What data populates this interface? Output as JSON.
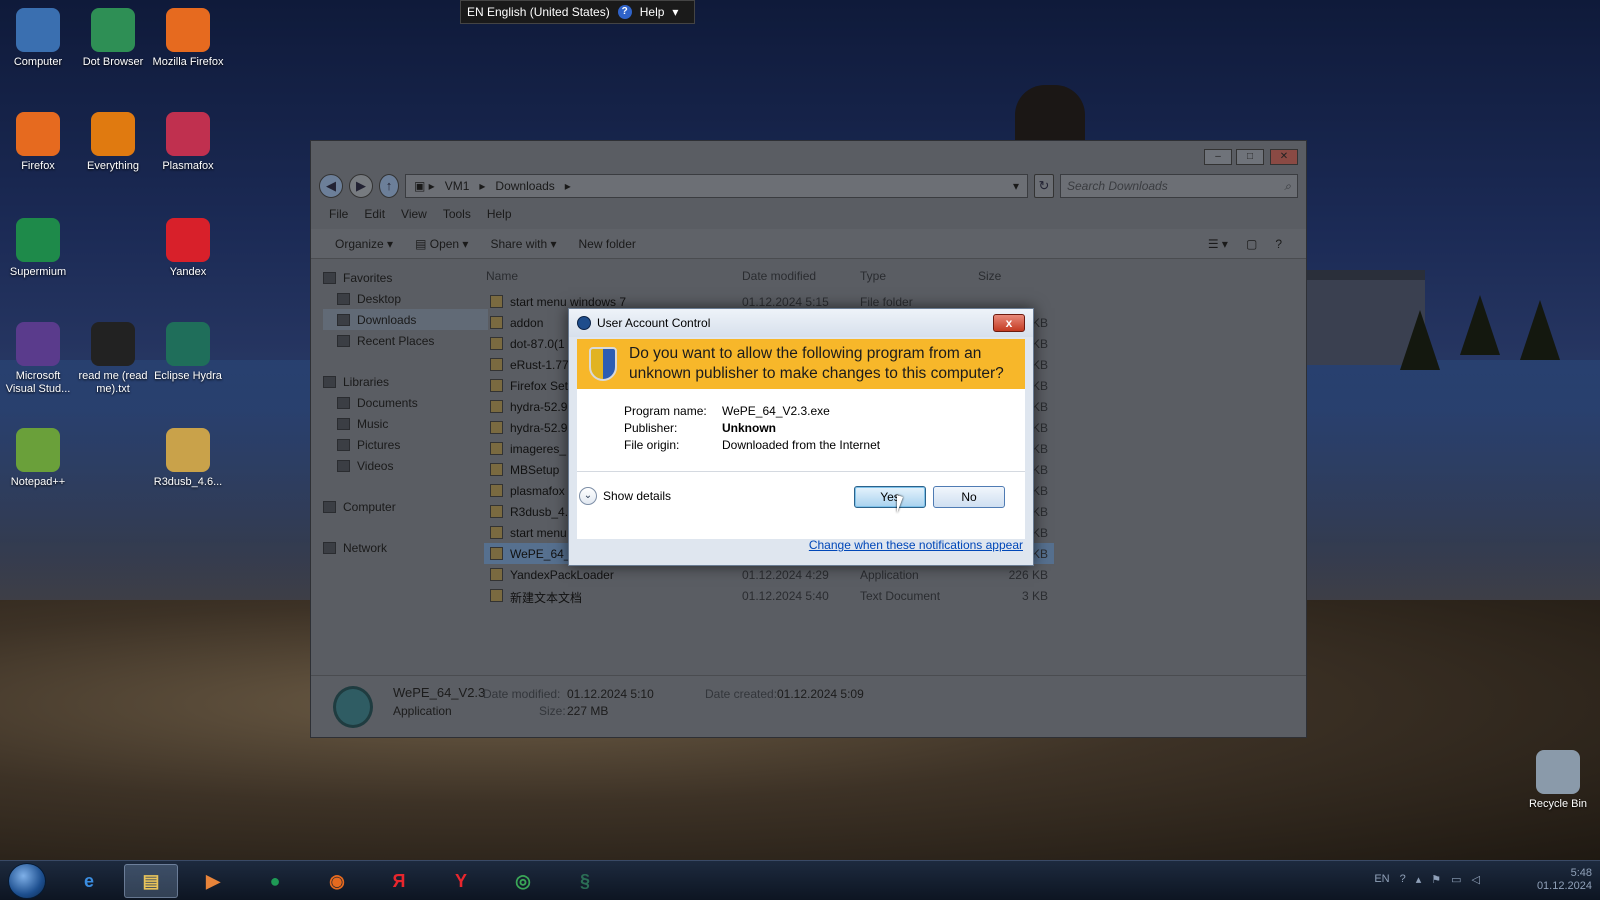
{
  "language_bar": {
    "language": "EN English (United States)",
    "help": "Help"
  },
  "desktop_icons": [
    {
      "label": "Computer",
      "icon": "computer-icon",
      "color": "#3a6fb0"
    },
    {
      "label": "Dot Browser",
      "icon": "dot-browser-icon",
      "color": "#2e8f55"
    },
    {
      "label": "Mozilla Firefox",
      "icon": "firefox-icon",
      "color": "#e66a1f"
    },
    {
      "label": "Firefox",
      "icon": "firefox-icon",
      "color": "#e66a1f"
    },
    {
      "label": "Everything",
      "icon": "everything-icon",
      "color": "#e07a10"
    },
    {
      "label": "Plasmafox",
      "icon": "plasmafox-icon",
      "color": "#c0304f"
    },
    {
      "label": "Supermium",
      "icon": "supermium-icon",
      "color": "#1e8a4a"
    },
    {
      "label": "Yandex",
      "icon": "yandex-icon",
      "color": "#d8202a"
    },
    {
      "label": "Microsoft Visual Stud...",
      "icon": "visual-studio-icon",
      "color": "#5a3b8c"
    },
    {
      "label": "read me (read me).txt",
      "icon": "text-file-icon",
      "color": "#222222"
    },
    {
      "label": "Eclipse Hydra",
      "icon": "eclipse-hydra-icon",
      "color": "#1f6e5a"
    },
    {
      "label": "Notepad++",
      "icon": "notepad-plus-plus-icon",
      "color": "#6aa03a"
    },
    {
      "label": "R3dusb_4.6...",
      "icon": "folder-icon",
      "color": "#c9a24a"
    },
    {
      "label": "Recycle Bin",
      "icon": "recycle-bin-icon",
      "color": "#8a9aaa"
    }
  ],
  "explorer": {
    "breadcrumb": [
      "VM1",
      "Downloads"
    ],
    "search_placeholder": "Search Downloads",
    "menu": [
      "File",
      "Edit",
      "View",
      "Tools",
      "Help"
    ],
    "commands": {
      "organize": "Organize",
      "open": "Open",
      "share": "Share with",
      "new_folder": "New folder"
    },
    "nav": {
      "favorites": "Favorites",
      "fav_items": [
        "Desktop",
        "Downloads",
        "Recent Places"
      ],
      "libraries": "Libraries",
      "lib_items": [
        "Documents",
        "Music",
        "Pictures",
        "Videos"
      ],
      "computer": "Computer",
      "network": "Network"
    },
    "columns": {
      "name": "Name",
      "date": "Date modified",
      "type": "Type",
      "size": "Size"
    },
    "files": [
      {
        "name": "start menu windows 7",
        "date": "01.12.2024 5:15",
        "type": "File folder",
        "size": ""
      },
      {
        "name": "addon",
        "date": "",
        "type": "",
        "size": "68 KB"
      },
      {
        "name": "dot-87.0(1",
        "date": "",
        "type": "",
        "size": "74 KB"
      },
      {
        "name": "eRust-1.77",
        "date": "",
        "type": "",
        "size": "73 KB"
      },
      {
        "name": "Firefox Set",
        "date": "",
        "type": "",
        "size": "00 KB"
      },
      {
        "name": "hydra-52.9",
        "date": "",
        "type": "",
        "size": "81 KB"
      },
      {
        "name": "hydra-52.9",
        "date": "",
        "type": "",
        "size": "53 KB"
      },
      {
        "name": "imageres_",
        "date": "",
        "type": "",
        "size": "89 KB"
      },
      {
        "name": "MBSetup",
        "date": "",
        "type": "",
        "size": "30 KB"
      },
      {
        "name": "plasmafox",
        "date": "",
        "type": "",
        "size": "16 KB"
      },
      {
        "name": "R3dusb_4.",
        "date": "",
        "type": "",
        "size": "55 KB"
      },
      {
        "name": "start menu",
        "date": "",
        "type": "",
        "size": "35 KB"
      },
      {
        "name": "WePE_64_",
        "date": "",
        "type": "",
        "size": "78 KB"
      },
      {
        "name": "YandexPackLoader",
        "date": "01.12.2024 4:29",
        "type": "Application",
        "size": "226 KB"
      },
      {
        "name": "新建文本文档",
        "date": "01.12.2024 5:40",
        "type": "Text Document",
        "size": "3 KB"
      }
    ],
    "selected_index": 12,
    "details": {
      "name": "WePE_64_V2.3",
      "kind": "Application",
      "date_modified_label": "Date modified:",
      "date_modified": "01.12.2024 5:10",
      "date_created_label": "Date created:",
      "date_created": "01.12.2024 5:09",
      "size_label": "Size:",
      "size": "227 MB"
    }
  },
  "uac": {
    "title": "User Account Control",
    "question": "Do you want to allow the following program from an unknown publisher to make changes to this computer?",
    "program_label": "Program name:",
    "program": "WePE_64_V2.3.exe",
    "publisher_label": "Publisher:",
    "publisher": "Unknown",
    "origin_label": "File origin:",
    "origin": "Downloaded from the Internet",
    "show_details": "Show details",
    "yes": "Yes",
    "no": "No",
    "link": "Change when these notifications appear",
    "close": "x"
  },
  "taskbar": {
    "pinned": [
      {
        "icon": "internet-explorer-icon",
        "glyph": "e",
        "color": "#3b8de0"
      },
      {
        "icon": "file-explorer-icon",
        "glyph": "▤",
        "color": "#e8c35a"
      },
      {
        "icon": "media-player-icon",
        "glyph": "▶",
        "color": "#e8843a"
      },
      {
        "icon": "supermium-icon",
        "glyph": "●",
        "color": "#1e9a55"
      },
      {
        "icon": "firefox-icon",
        "glyph": "◉",
        "color": "#e66a1f"
      },
      {
        "icon": "yandex-browser-icon",
        "glyph": "Я",
        "color": "#e8262d"
      },
      {
        "icon": "yandex-icon",
        "glyph": "Y",
        "color": "#e8262d"
      },
      {
        "icon": "chrome-icon",
        "glyph": "◎",
        "color": "#3aa757"
      },
      {
        "icon": "eclipse-hydra-icon",
        "glyph": "§",
        "color": "#2b6e55"
      }
    ],
    "active_index": 1,
    "tray_lang": "EN",
    "time": "5:48",
    "date": "01.12.2024"
  }
}
